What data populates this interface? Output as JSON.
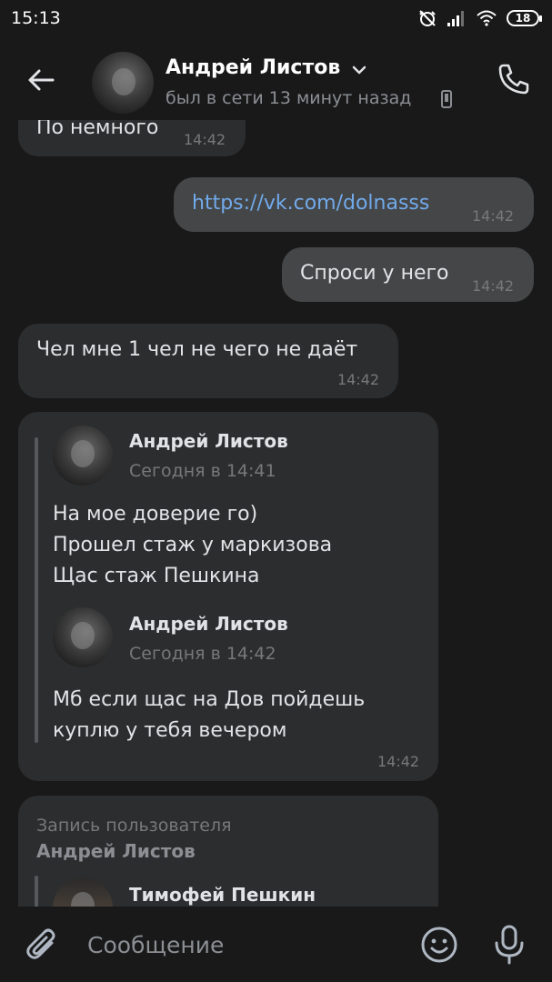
{
  "status_bar": {
    "time": "15:13",
    "battery": "18"
  },
  "header": {
    "name": "Андрей Листов",
    "status": "был в сети 13 минут назад"
  },
  "messages": [
    {
      "direction": "in",
      "text": "По немного",
      "time": "14:42"
    },
    {
      "direction": "out",
      "text": "https://vk.com/dolnasss",
      "time": "14:42"
    },
    {
      "direction": "out",
      "text": "Спроси у него",
      "time": "14:42"
    },
    {
      "direction": "in",
      "text": "Чел мне 1 чел не чего не даёт",
      "time": "14:42"
    }
  ],
  "forwarded_message": {
    "time": "14:42",
    "items": [
      {
        "author": "Андрей Листов",
        "date": "Сегодня в 14:41",
        "text": "На мое доверие го)\nПрошел стаж у маркизова\nЩас стаж Пешкина"
      },
      {
        "author": "Андрей Листов",
        "date": "Сегодня в 14:42",
        "text": "Мб если щас на Дов пойдешь\nкуплю у тебя вечером"
      }
    ]
  },
  "wall_post": {
    "label": "Запись пользователя",
    "author": "Андрей Листов",
    "inner_author": "Тимофей Пешкин"
  },
  "composer": {
    "placeholder": "Сообщение"
  },
  "colors": {
    "background": "#19191a",
    "incoming_bubble": "#2c2d2e",
    "outgoing_bubble": "#454647",
    "link": "#71aaeb",
    "accent_icon": "#aeb7c2"
  }
}
